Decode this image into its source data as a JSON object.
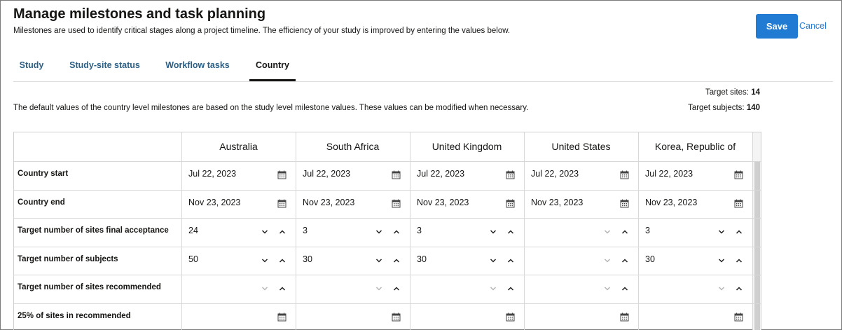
{
  "header": {
    "title": "Manage milestones and task planning",
    "subtitle": "Milestones are used to identify critical stages along a project timeline. The efficiency of your study is improved by entering the values below.",
    "save_label": "Save",
    "cancel_label": "Cancel"
  },
  "tabs": [
    {
      "label": "Study",
      "active": false
    },
    {
      "label": "Study-site status",
      "active": false
    },
    {
      "label": "Workflow tasks",
      "active": false
    },
    {
      "label": "Country",
      "active": true
    }
  ],
  "intro": "The default values of the country level milestones are based on the study level milestone values. These values can be modified when necessary.",
  "targets": {
    "sites_label": "Target sites:",
    "sites_value": "14",
    "subjects_label": "Target subjects:",
    "subjects_value": "140"
  },
  "table": {
    "countries": [
      "Australia",
      "South Africa",
      "United Kingdom",
      "United States",
      "Korea, Republic of"
    ],
    "rows": [
      {
        "label": "Country start",
        "kind": "date",
        "values": [
          "Jul 22, 2023",
          "Jul 22, 2023",
          "Jul 22, 2023",
          "Jul 22, 2023",
          "Jul 22, 2023"
        ]
      },
      {
        "label": "Country end",
        "kind": "date",
        "values": [
          "Nov 23, 2023",
          "Nov 23, 2023",
          "Nov 23, 2023",
          "Nov 23, 2023",
          "Nov 23, 2023"
        ]
      },
      {
        "label": "Target number of sites final acceptance",
        "kind": "number",
        "values": [
          "24",
          "3",
          "3",
          "",
          "3"
        ]
      },
      {
        "label": "Target number of subjects",
        "kind": "number",
        "values": [
          "50",
          "30",
          "30",
          "",
          "30"
        ]
      },
      {
        "label": "Target number of sites recommended",
        "kind": "number",
        "values": [
          "",
          "",
          "",
          "",
          ""
        ]
      },
      {
        "label": "25% of sites in recommended",
        "kind": "date",
        "values": [
          "",
          "",
          "",
          "",
          ""
        ]
      }
    ]
  },
  "icons": {
    "calendar": "calendar-icon",
    "decrease": "chevron-down-icon",
    "increase": "chevron-up-icon"
  },
  "colors": {
    "primary": "#227bd2",
    "tab_text": "#2b5f85",
    "grid_line": "#d8d8d8"
  }
}
